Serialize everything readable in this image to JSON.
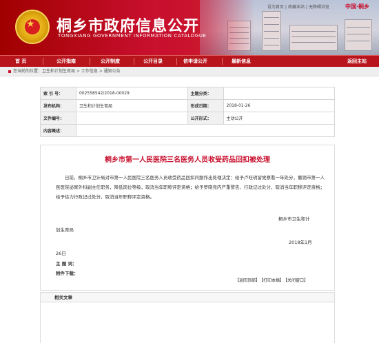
{
  "header": {
    "title": "桐乡市政府信息公开",
    "subtitle": "TONGXIANG GOVERNMENT INFORMATION CATALOGUE",
    "top_links": [
      "设为首页",
      "收藏本站",
      "无障碍浏览"
    ],
    "logo_text": "中国·桐乡"
  },
  "nav": {
    "items": [
      "首  页",
      "公开指南",
      "公开制度",
      "公开目录",
      "依申请公开",
      "最新信息",
      "返回主站"
    ]
  },
  "breadcrumb": {
    "text": "您当前的位置：卫生和计划生育局 > 工作信息 > 通知公告"
  },
  "info": {
    "index_label": "索 引 号：",
    "index_value": "002558542/2018-00029",
    "topic_label": "主题分类：",
    "topic_value": "",
    "issuer_label": "发布机构：",
    "issuer_value": "卫生和计划生育局",
    "date_label": "形成日期：",
    "date_value": "2018-01-26",
    "docno_label": "文件编号：",
    "docno_value": "",
    "form_label": "公开形式：",
    "form_value": "主动公开",
    "summary_label": "内容概述：",
    "summary_value": ""
  },
  "article": {
    "title": "桐乡市第一人民医院三名医务人员收受药品回扣被处理",
    "paragraph": "日前，桐乡市卫计局对市第一人民医院三名医务人员收受药品回扣问题作出处理决定：给予卢旺玥留党察看一年处分，撤销市第一人民医院泌尿外科副主任职务，降低岗位等级，取消当年职称评定资格；给予罗晓竞内严重警告、行政记过处分，取消当年职称评定资格；给予徐力行政记过处分，取消当年职称评定资格。",
    "sign_line1": "桐乡市卫生和计",
    "sign_line2": "划生育局",
    "date_line1": "2018年1月",
    "date_line2": "26日",
    "keywords_label": "主 题 词：",
    "attachment_label": "附件下载："
  },
  "actions": [
    "【返回顶部】",
    "【打印本稿】",
    "【关闭窗口】"
  ],
  "related": {
    "heading": "相关文章"
  }
}
